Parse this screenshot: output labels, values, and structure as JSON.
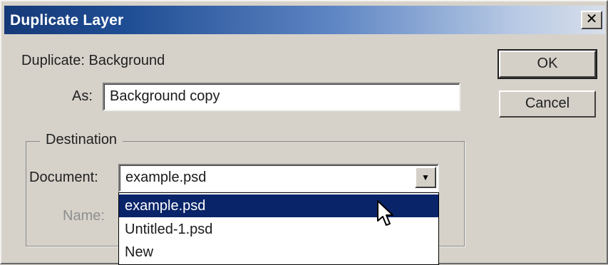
{
  "window": {
    "title": "Duplicate Layer",
    "close_glyph": "✕",
    "close_icon": "close-icon"
  },
  "duplicate": {
    "label": "Duplicate: Background",
    "as_label": "As:",
    "as_value": "Background copy"
  },
  "buttons": {
    "ok": "OK",
    "cancel": "Cancel"
  },
  "destination": {
    "group_label": "Destination",
    "document_label": "Document:",
    "document_value": "example.psd",
    "dropdown_arrow_icon": "chevron-down-icon",
    "dropdown_arrow_glyph": "▼",
    "name_label": "Name:",
    "options": [
      "example.psd",
      "Untitled-1.psd",
      "New"
    ],
    "selected_index": 0
  },
  "colors": {
    "selection_bg": "#0a246a",
    "title_gradient_start": "#163a78",
    "dialog_bg": "#d6d2ca"
  }
}
